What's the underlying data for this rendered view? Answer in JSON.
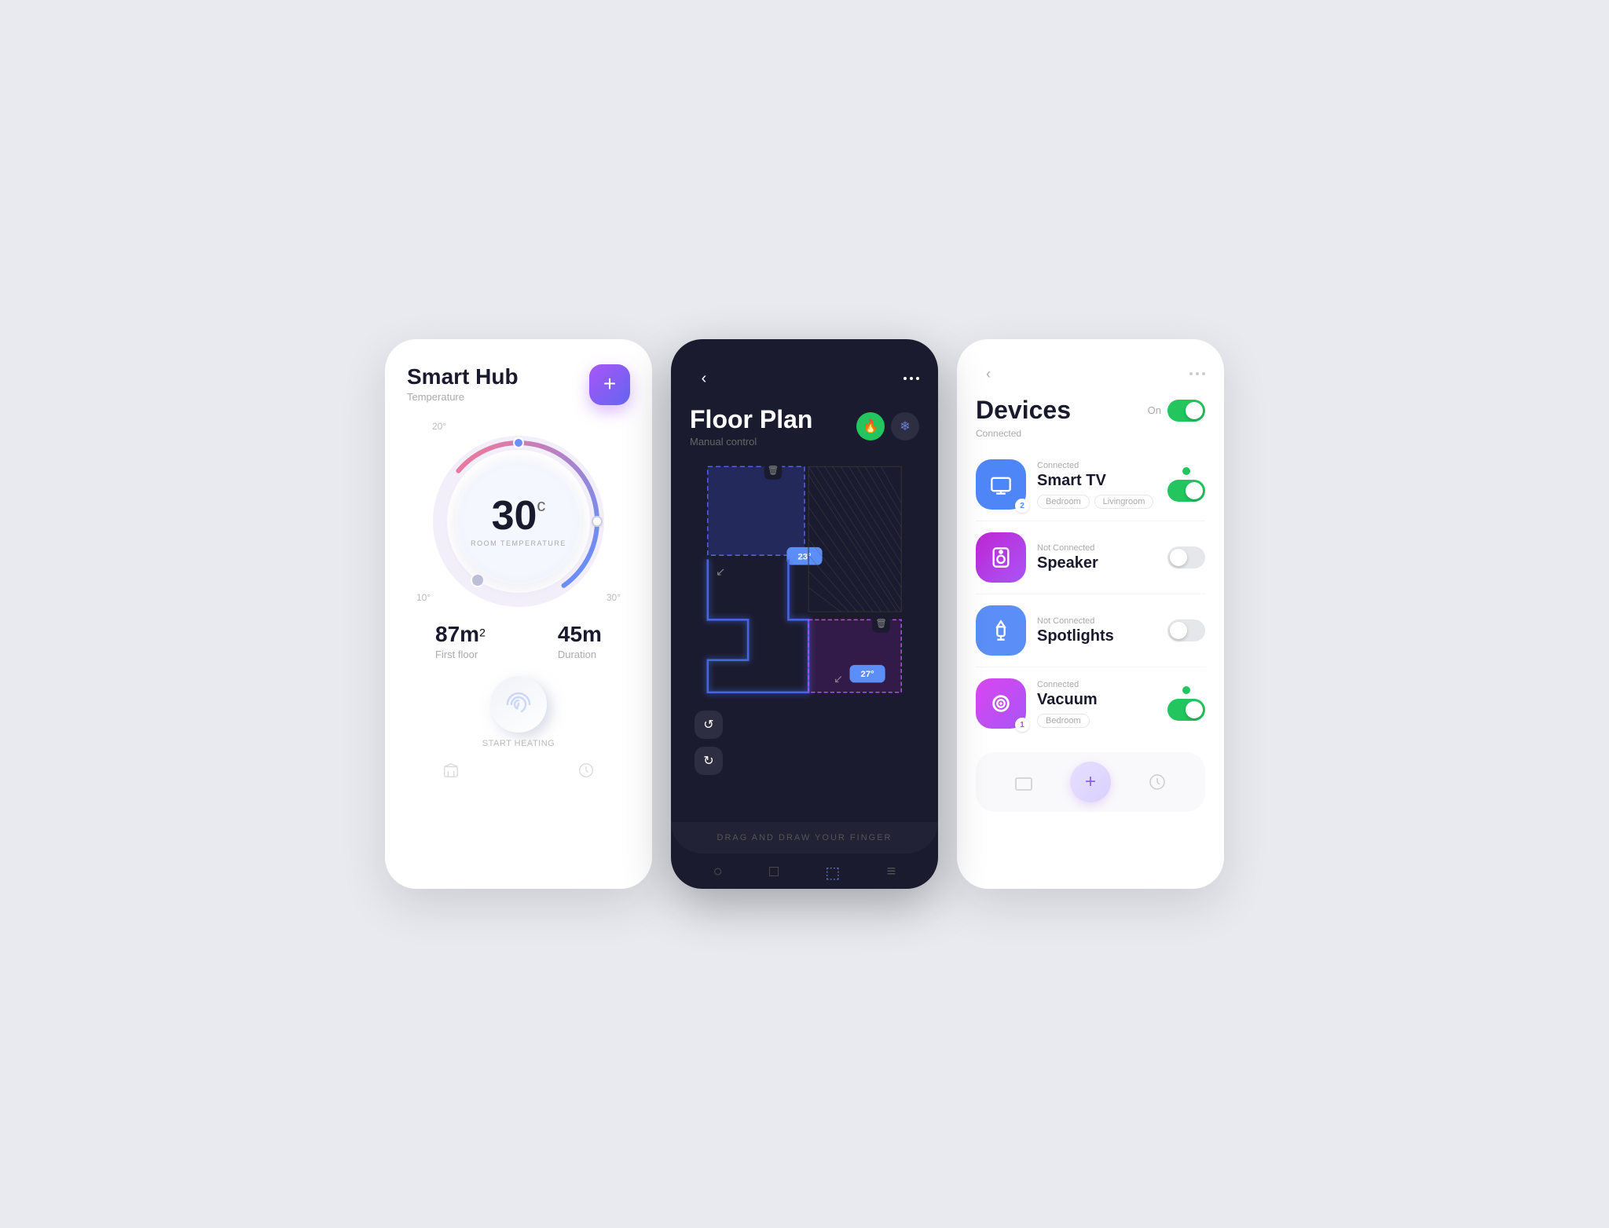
{
  "smarthub": {
    "title": "Smart Hub",
    "subtitle": "Temperature",
    "add_label": "+",
    "ring_label_20": "20°",
    "ring_label_10": "10°",
    "ring_label_30": "30°",
    "temperature": "30",
    "temp_unit": "c",
    "room_temp_label": "ROOM TEMPERATURE",
    "stat1_value": "87m",
    "stat1_sup": "2",
    "stat1_label": "First floor",
    "stat2_value": "45m",
    "stat2_label": "Duration",
    "start_heating": "START HEATING"
  },
  "floorplan": {
    "title": "Floor Plan",
    "subtitle": "Manual control",
    "drag_text": "DRAG AND DRAW YOUR FINGER",
    "room1_temp": "23°",
    "room2_temp": "27°"
  },
  "devices": {
    "title": "Devices",
    "on_label": "On",
    "connected_label": "Connected",
    "items": [
      {
        "id": "smart-tv",
        "status": "Connected",
        "name": "Smart TV",
        "badge": "2",
        "tags": [
          "Bedroom",
          "Livingroom"
        ],
        "connected": true,
        "icon_type": "tv"
      },
      {
        "id": "speaker",
        "status": "Not Connected",
        "name": "Speaker",
        "badge": null,
        "tags": [],
        "connected": false,
        "icon_type": "speaker"
      },
      {
        "id": "spotlights",
        "status": "Not Connected",
        "name": "Spotlights",
        "badge": null,
        "tags": [],
        "connected": false,
        "icon_type": "light"
      },
      {
        "id": "vacuum",
        "status": "Connected",
        "name": "Vacuum",
        "badge": "1",
        "tags": [
          "Bedroom"
        ],
        "connected": true,
        "icon_type": "vacuum"
      }
    ]
  }
}
